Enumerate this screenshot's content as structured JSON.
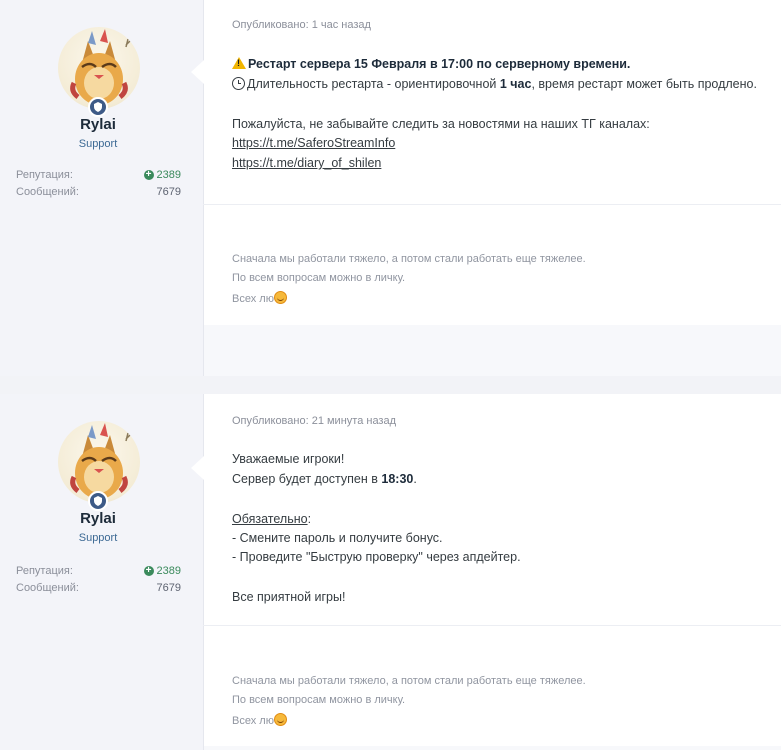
{
  "posts": [
    {
      "author": {
        "name": "Rylai",
        "group": "Support",
        "rep_label": "Репутация:",
        "rep_value": "2389",
        "posts_label": "Сообщений:",
        "posts_value": "7679"
      },
      "meta": "Опубликовано: 1 час назад",
      "lines": {
        "title": "Рестарт сервера 15 Февраля в 17:00 по серверному времени.",
        "duration_a": "Длительность рестарта -  ориентировочной ",
        "duration_b": "1 час",
        "duration_c": ", время рестарт может быть продлено.",
        "follow": "Пожалуйста, не забывайте следить за новостями на наших ТГ каналах:",
        "link1": "https://t.me/SaferoStreamInfo",
        "link2": "https://t.me/diary_of_shilen"
      },
      "signature": [
        "Сначала мы работали тяжело, а потом стали работать еще тяжелее.",
        "По всем вопросам можно в личку.",
        "Всех лю"
      ]
    },
    {
      "author": {
        "name": "Rylai",
        "group": "Support",
        "rep_label": "Репутация:",
        "rep_value": "2389",
        "posts_label": "Сообщений:",
        "posts_value": "7679"
      },
      "meta": "Опубликовано: 21 минута назад",
      "lines": {
        "greeting": "Уважаемые игроки!",
        "available_a": "Сервер будет доступен в ",
        "available_b": "18:30",
        "available_c": ".",
        "required": "Обязательно",
        "required_colon": ":",
        "step1": " - Смените пароль и получите бонус.",
        "step2": " - Проведите \"Быструю проверку\" через апдейтер.",
        "closing": "Все приятной игры!"
      },
      "signature": [
        "Сначала мы работали тяжело, а потом стали работать еще тяжелее.",
        "По всем вопросам можно в личку.",
        "Всех лю"
      ]
    }
  ],
  "icons": {
    "warning": "warning-icon",
    "clock": "clock-icon",
    "smile": "smile-emoji-icon",
    "reputation": "plus-circle-icon",
    "badge": "shield-badge-icon"
  },
  "colors": {
    "rep_green": "#3a8a5c",
    "group_blue": "#3c6994",
    "sidebar": "#f3f4f9"
  }
}
